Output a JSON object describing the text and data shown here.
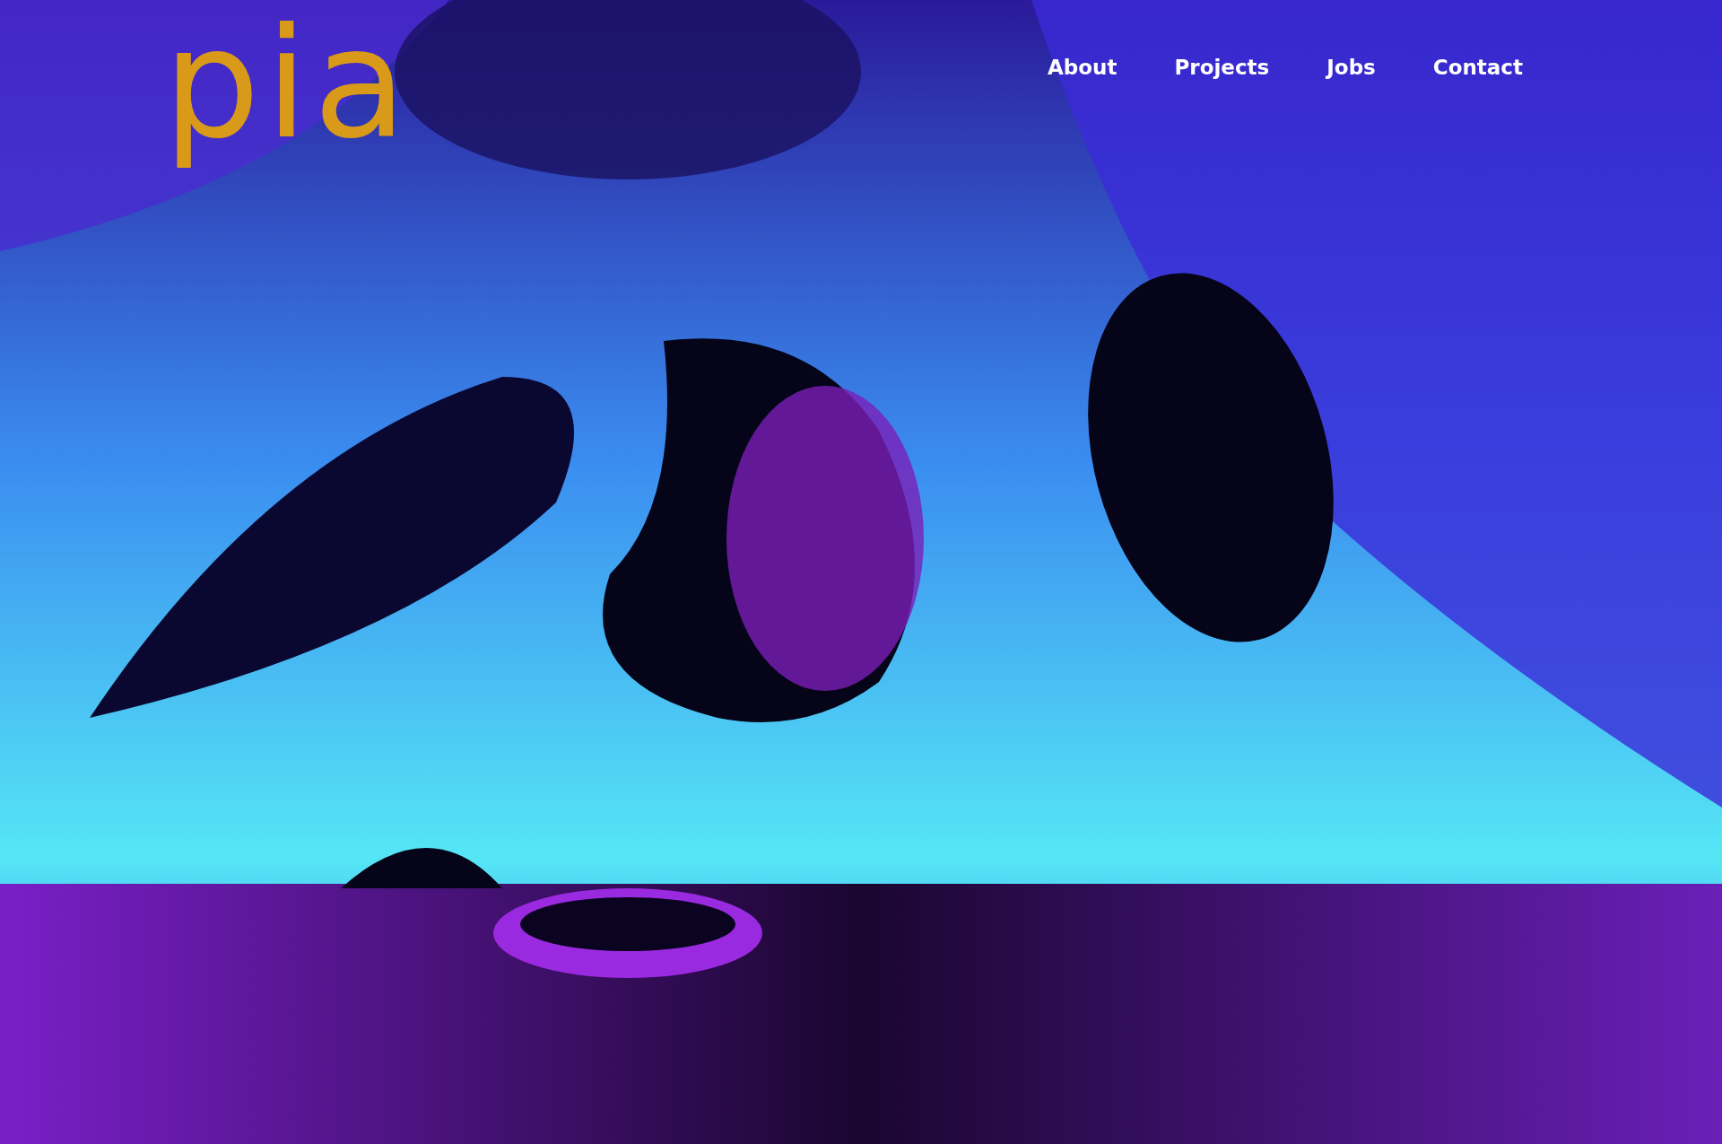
{
  "logo": {
    "text": "pia"
  },
  "nav": [
    {
      "label": "About"
    },
    {
      "label": "Projects"
    },
    {
      "label": "Jobs"
    },
    {
      "label": "Contact"
    }
  ]
}
